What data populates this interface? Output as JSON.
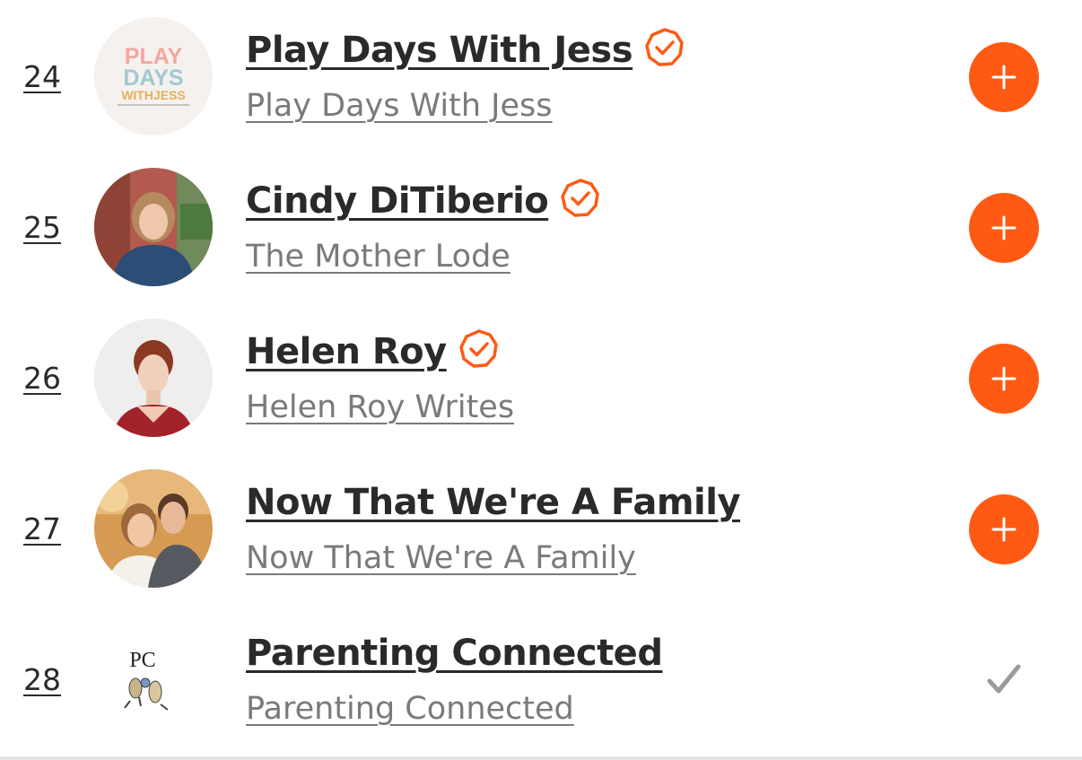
{
  "items": [
    {
      "rank": "24",
      "title": "Play Days With Jess",
      "subtitle": "Play Days With Jess",
      "verified": true,
      "action": "subscribe",
      "avatar_text": [
        "PLAY",
        "DAYS",
        "WITHJESS"
      ]
    },
    {
      "rank": "25",
      "title": "Cindy DiTiberio",
      "subtitle": "The Mother Lode",
      "verified": true,
      "action": "subscribe"
    },
    {
      "rank": "26",
      "title": "Helen Roy",
      "subtitle": "Helen Roy Writes",
      "verified": true,
      "action": "subscribe"
    },
    {
      "rank": "27",
      "title": "Now That We're A Family",
      "subtitle": "Now That We're A Family",
      "verified": false,
      "action": "subscribe"
    },
    {
      "rank": "28",
      "title": "Parenting Connected",
      "subtitle": "Parenting Connected",
      "verified": false,
      "action": "subscribed",
      "avatar_text": "PC"
    }
  ],
  "icons": {
    "verified": "verified-badge-icon",
    "subscribe": "plus-icon",
    "subscribed": "checkmark-icon"
  },
  "colors": {
    "accent": "#ff5a14",
    "title_text": "#2a2a2a",
    "subtitle_text": "#7a7a7a",
    "check": "#9a9a9a"
  }
}
